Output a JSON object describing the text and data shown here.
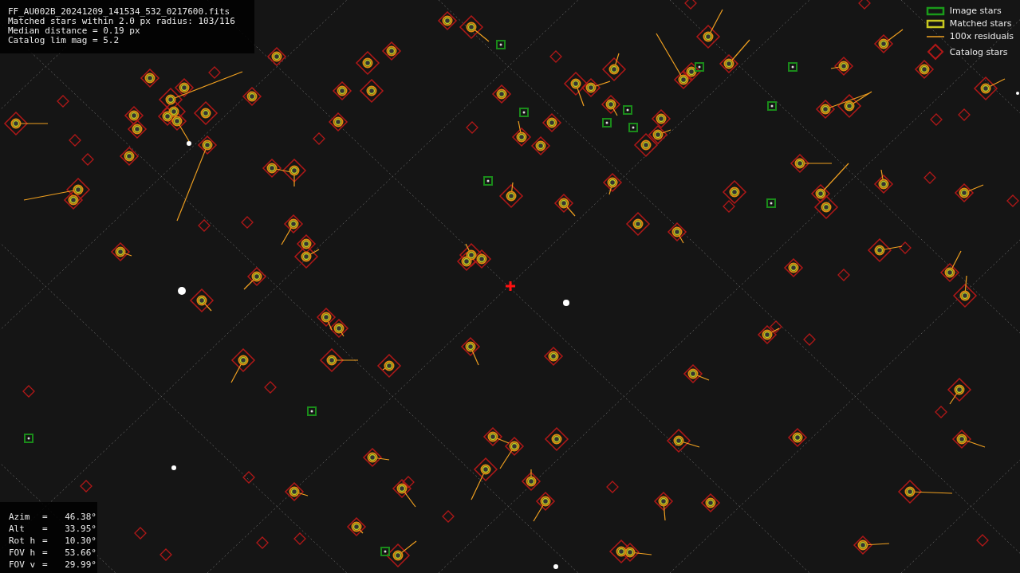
{
  "info_box": {
    "lines": [
      "FF_AU002B_20241209_141534_532_0217600.fits",
      "Matched stars within 2.0 px radius: 103/116",
      "Median distance = 0.19 px",
      "Catalog lim mag = 5.2"
    ]
  },
  "legend": {
    "items": [
      {
        "kind": "image",
        "label": "Image stars"
      },
      {
        "kind": "matched",
        "label": "Matched stars"
      },
      {
        "kind": "residual",
        "label": "100x residuals"
      },
      {
        "kind": "catalog",
        "label": "Catalog stars"
      }
    ]
  },
  "pointing": {
    "rows": [
      {
        "label": "Azim",
        "sep": "=",
        "value": "46.38°"
      },
      {
        "label": "Alt",
        "sep": "=",
        "value": "33.95°"
      },
      {
        "label": "Rot h",
        "sep": "=",
        "value": "10.30°"
      },
      {
        "label": "FOV h",
        "sep": "=",
        "value": "53.66°"
      },
      {
        "label": "FOV v",
        "sep": "=",
        "value": "29.99°"
      }
    ]
  }
}
